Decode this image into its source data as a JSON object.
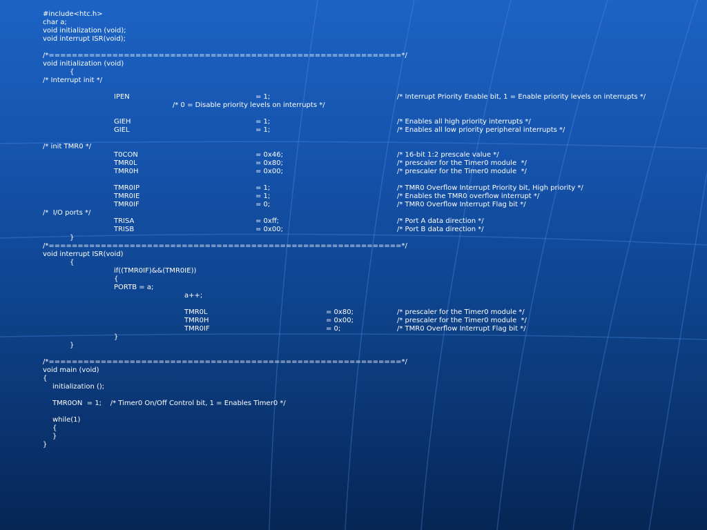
{
  "slide": {
    "lines": [
      "#include<htc.h>",
      "char a;",
      "void initialization (void);",
      "void interrupt ISR(void);",
      "/*=============================================================*/",
      "void initialization (void)",
      "{",
      "/* Interrupt init */",
      "IPEN",
      "= 1;",
      "/* Interrupt Priority Enable bit, 1 = Enable priority levels on interrupts */",
      "/* 0 = Disable priority levels on interrupts */",
      "GIEH",
      "= 1;",
      "/* Enables all high priority interrupts */",
      "GIEL",
      "= 1;",
      "/* Enables all low priority peripheral interrupts */",
      "/* init TMR0 */",
      "T0CON",
      "= 0x46;",
      "/* 16-bit 1:2 prescale value */",
      "TMR0L",
      "= 0x80;",
      "/* prescaler for the Timer0 module  */",
      "TMR0H",
      "= 0x00;",
      "/* prescaler for the Timer0 module  */",
      "TMR0IP",
      "= 1;",
      "/* TMR0 Overflow Interrupt Priority bit, High priority */",
      "TMR0IE",
      "= 1;",
      "/* Enables the TMR0 overflow interrupt */",
      "TMR0IF",
      "= 0;",
      "/* TMR0 Overflow Interrupt Flag bit */",
      "/*  I/O ports */",
      "TRISA",
      "= 0xff;",
      "/* Port A data direction */",
      "TRISB",
      "= 0x00;",
      "/* Port B data direction */",
      "}",
      "/*=============================================================*/",
      "void interrupt ISR(void)",
      "{",
      "if((TMR0IF)&&(TMR0IE))",
      "{",
      "PORTB = a;",
      "a++;",
      "TMR0L",
      "= 0x80;",
      "/* prescaler for the Timer0 module */",
      "TMR0H",
      "= 0x00;",
      "/* prescaler for the Timer0 module  */",
      "TMR0IF",
      "= 0;",
      "/* TMR0 Overflow Interrupt Flag bit */",
      "}",
      "}",
      "/*=============================================================*/",
      "void main (void)",
      "{",
      "initialization ();",
      "TMR0ON  = 1;    /* Timer0 On/Off Control bit, 1 = Enables Timer0 */",
      "while(1)",
      "{",
      "}",
      "}"
    ]
  }
}
